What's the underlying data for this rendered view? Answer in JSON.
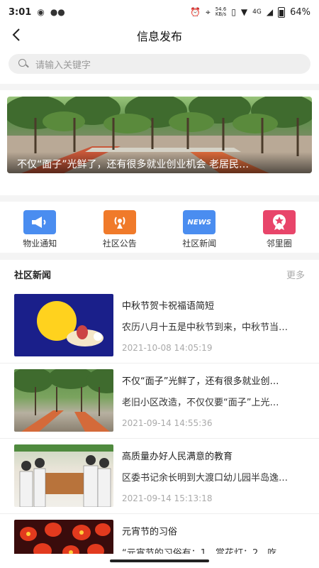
{
  "status": {
    "time": "3:01",
    "net_speed": "54.6",
    "net_unit": "KB/s",
    "signal": "4G",
    "battery": "64%",
    "icons": [
      "weibo-icon",
      "wechat-icon",
      "alarm-icon",
      "location-icon",
      "vibrate-icon",
      "wifi-icon",
      "signal-icon",
      "battery-icon"
    ]
  },
  "nav": {
    "title": "信息发布"
  },
  "search": {
    "placeholder": "请输入关键字"
  },
  "banner": {
    "caption": "不仅“面子”光鲜了，还有很多就业创业机会 老居民…"
  },
  "quick": [
    {
      "label": "物业通知",
      "icon": "megaphone-icon",
      "color": "#4a8df0"
    },
    {
      "label": "社区公告",
      "icon": "broadcast-icon",
      "color": "#f07a2a"
    },
    {
      "label": "社区新闻",
      "icon": "news-icon",
      "icon_text": "NEWS",
      "color": "#4a8df0"
    },
    {
      "label": "邻里圈",
      "icon": "badge-icon",
      "color": "#e8456a"
    }
  ],
  "news": {
    "title": "社区新闻",
    "more": "更多",
    "items": [
      {
        "title": "中秋节贺卡祝福语简短",
        "summary": "农历八月十五是中秋节到来，中秋节当…",
        "date": "2021-10-08 14:05:19"
      },
      {
        "title": "不仅“面子”光鲜了，还有很多就业创…",
        "summary": "老旧小区改造，不仅仅要“面子”上光…",
        "date": "2021-09-14 14:55:36"
      },
      {
        "title": "高质量办好人民满意的教育",
        "summary": "区委书记余长明到大渡口幼儿园半岛逸…",
        "date": "2021-09-14 15:13:18"
      },
      {
        "title": "元宵节的习俗",
        "summary": "“元宵节的习俗有：1、赏花灯；2、吃…",
        "date": ""
      }
    ]
  },
  "colors": {
    "accent_blue": "#4a8df0",
    "accent_orange": "#f07a2a",
    "accent_pink": "#e8456a"
  }
}
